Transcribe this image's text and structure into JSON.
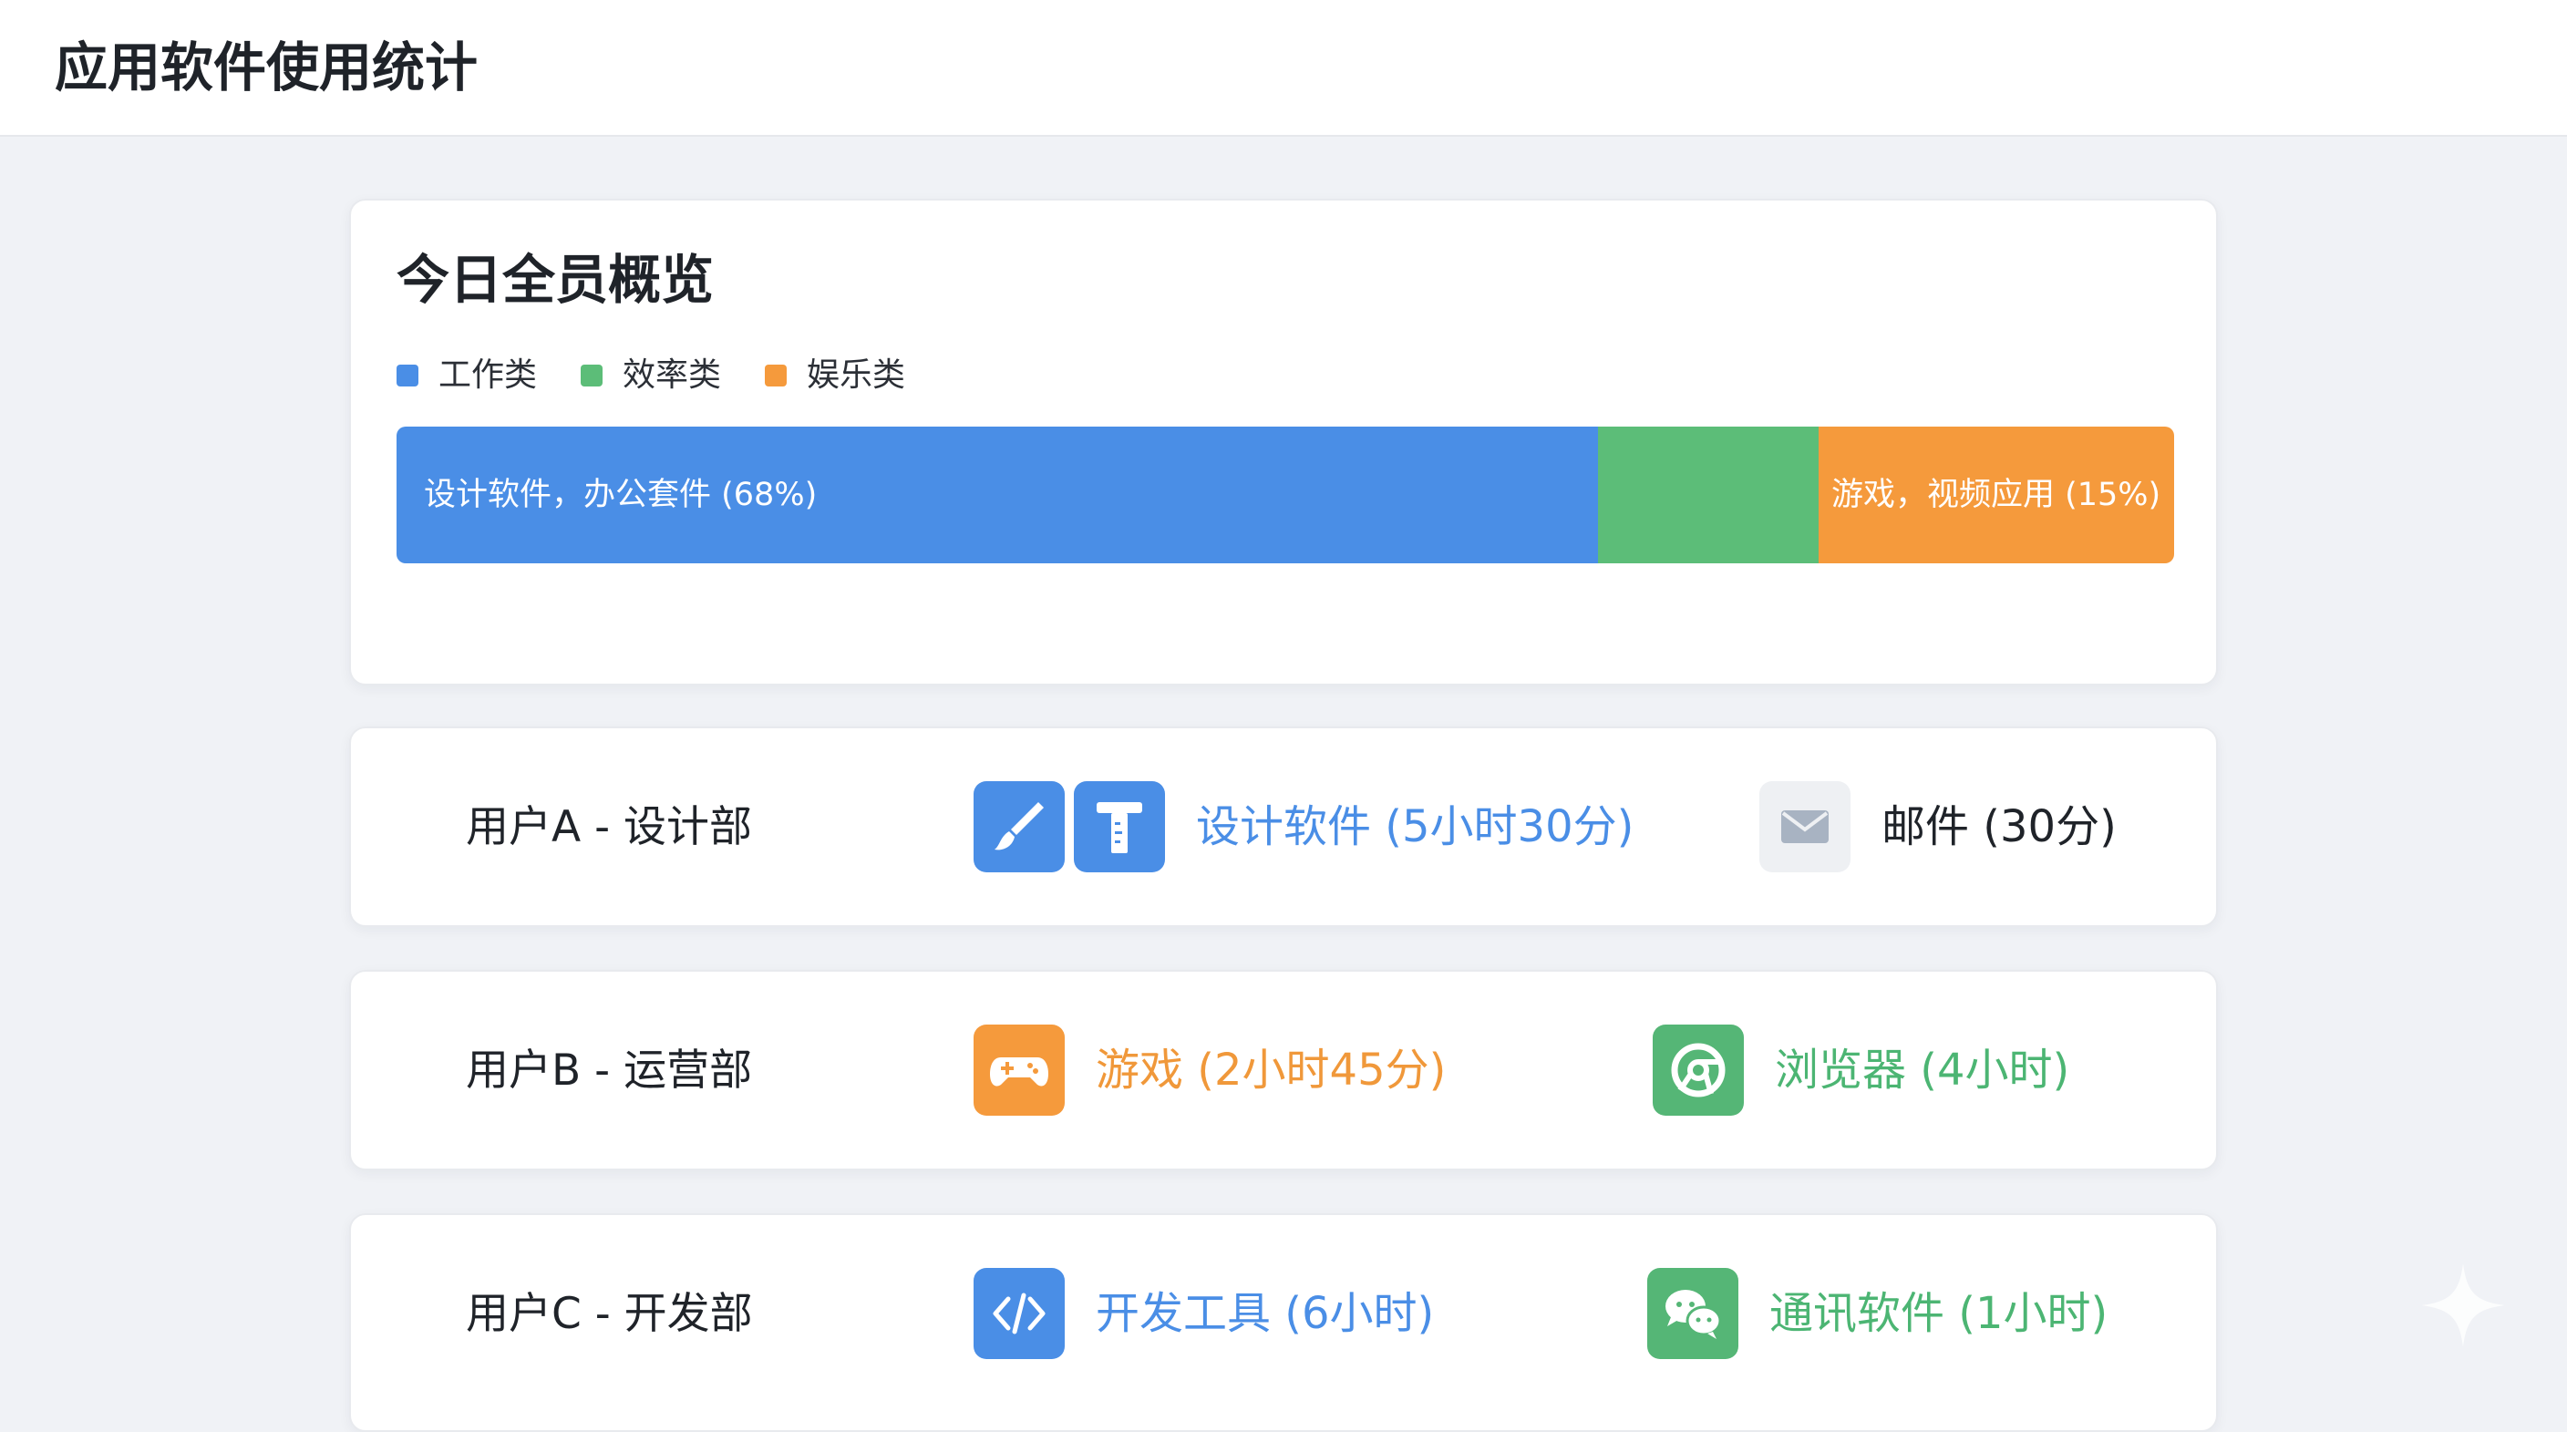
{
  "app": {
    "title": "应用软件使用统计"
  },
  "overview": {
    "title": "今日全员概览",
    "legend": [
      {
        "label": "工作类",
        "color": "#4a8ee6"
      },
      {
        "label": "效率类",
        "color": "#5cbd78"
      },
      {
        "label": "娱乐类",
        "color": "#f59a3c"
      }
    ],
    "bar": [
      {
        "category": "工作类",
        "percent": 68,
        "label": "设计软件，办公套件 (68%)",
        "color": "#4a8ee6"
      },
      {
        "category": "效率类",
        "percent": 12.4,
        "label": "",
        "color": "#5cbd78"
      },
      {
        "category": "娱乐类",
        "percent": 20,
        "label": "游戏，视频应用 (15%)",
        "color": "#f59a3c"
      }
    ]
  },
  "users": [
    {
      "name": "用户A - 设计部",
      "apps": [
        {
          "icons": [
            "brush-icon",
            "ruler-icon"
          ],
          "label": "设计软件 (5小时30分)",
          "color": "blue"
        },
        {
          "icons": [
            "mail-icon"
          ],
          "label": "邮件 (30分)",
          "color": "dark"
        }
      ]
    },
    {
      "name": "用户B - 运营部",
      "apps": [
        {
          "icons": [
            "gamepad-icon"
          ],
          "label": "游戏 (2小时45分)",
          "color": "orange"
        },
        {
          "icons": [
            "browser-icon"
          ],
          "label": "浏览器 (4小时)",
          "color": "green"
        }
      ]
    },
    {
      "name": "用户C - 开发部",
      "apps": [
        {
          "icons": [
            "code-icon"
          ],
          "label": "开发工具 (6小时)",
          "color": "blue"
        },
        {
          "icons": [
            "chat-icon"
          ],
          "label": "通讯软件 (1小时)",
          "color": "green"
        }
      ]
    }
  ]
}
